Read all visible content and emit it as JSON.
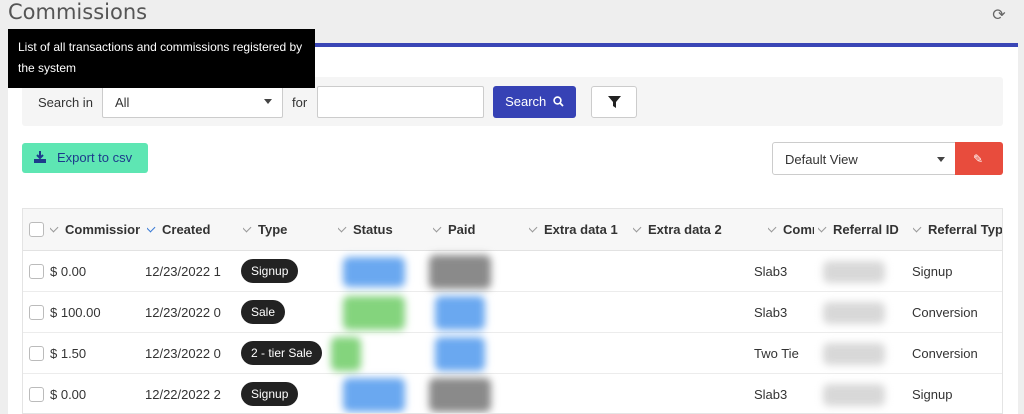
{
  "page": {
    "title": "Commissions"
  },
  "tooltip": {
    "text": "List of all transactions and commissions registered by the system"
  },
  "search": {
    "label_in": "Search in",
    "select_value": "All",
    "label_for": "for",
    "input_value": "",
    "button_label": "Search"
  },
  "toolbar": {
    "export_label": "Export to csv",
    "view_value": "Default View"
  },
  "table": {
    "columns": [
      "Commission",
      "Created",
      "Type",
      "Status",
      "Paid",
      "Extra data 1",
      "Extra data 2",
      "Commission group",
      "Referral ID",
      "Referral Type"
    ],
    "rows": [
      {
        "commission": "$ 0.00",
        "created": "12/23/2022 1",
        "type": "Signup",
        "group": "Slab3",
        "referral_type": "Signup",
        "status_color": "#6aa8f0",
        "paid_color": "#8a8a8a"
      },
      {
        "commission": "$ 100.00",
        "created": "12/23/2022 0",
        "type": "Sale",
        "group": "Slab3",
        "referral_type": "Conversion",
        "status_color": "#84d47d",
        "paid_color": "#6aa8f0"
      },
      {
        "commission": "$ 1.50",
        "created": "12/23/2022 0",
        "type": "2 - tier Sale",
        "group": "Two Tie",
        "referral_type": "Conversion",
        "status_color": "#84d47d",
        "paid_color": "#6aa8f0"
      },
      {
        "commission": "$ 0.00",
        "created": "12/22/2022 2",
        "type": "Signup",
        "group": "Slab3",
        "referral_type": "Signup",
        "status_color": "#6aa8f0",
        "paid_color": "#8a8a8a"
      }
    ]
  },
  "colors": {
    "accent": "#3642b5",
    "export": "#5ee6b3",
    "edit": "#e84c3d"
  }
}
